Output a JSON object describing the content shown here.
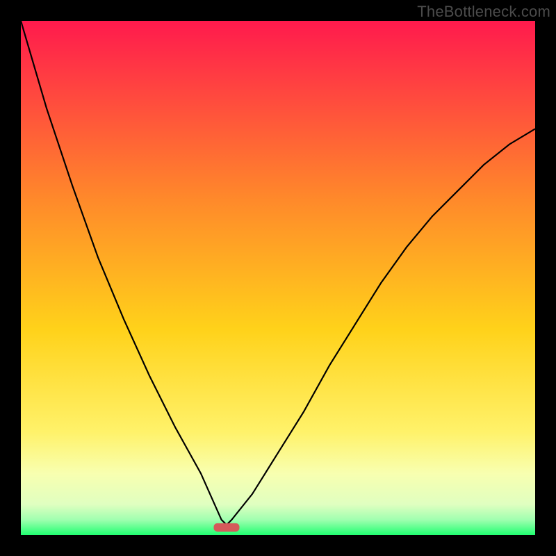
{
  "watermark": "TheBottleneck.com",
  "chart_data": {
    "type": "line",
    "title": "",
    "xlabel": "",
    "ylabel": "",
    "xlim": [
      0,
      1
    ],
    "ylim": [
      0,
      1
    ],
    "series": [
      {
        "name": "curve",
        "x": [
          0.0,
          0.05,
          0.1,
          0.15,
          0.2,
          0.25,
          0.3,
          0.35,
          0.39,
          0.4,
          0.41,
          0.45,
          0.5,
          0.55,
          0.6,
          0.65,
          0.7,
          0.75,
          0.8,
          0.85,
          0.9,
          0.95,
          1.0
        ],
        "y": [
          1.0,
          0.83,
          0.68,
          0.54,
          0.42,
          0.31,
          0.21,
          0.12,
          0.03,
          0.02,
          0.03,
          0.08,
          0.16,
          0.24,
          0.33,
          0.41,
          0.49,
          0.56,
          0.62,
          0.67,
          0.72,
          0.76,
          0.79
        ]
      }
    ],
    "marker": {
      "x_center": 0.4,
      "y": 0.015,
      "half_width": 0.025,
      "color": "#d45a5a"
    },
    "gradient_stops": [
      {
        "offset": 0.0,
        "color": "#ff1a4d"
      },
      {
        "offset": 0.35,
        "color": "#ff8a2a"
      },
      {
        "offset": 0.6,
        "color": "#ffd21a"
      },
      {
        "offset": 0.8,
        "color": "#fff26a"
      },
      {
        "offset": 0.88,
        "color": "#f8ffb0"
      },
      {
        "offset": 0.94,
        "color": "#e0ffc0"
      },
      {
        "offset": 0.97,
        "color": "#a0ffb0"
      },
      {
        "offset": 1.0,
        "color": "#1fff70"
      }
    ]
  }
}
